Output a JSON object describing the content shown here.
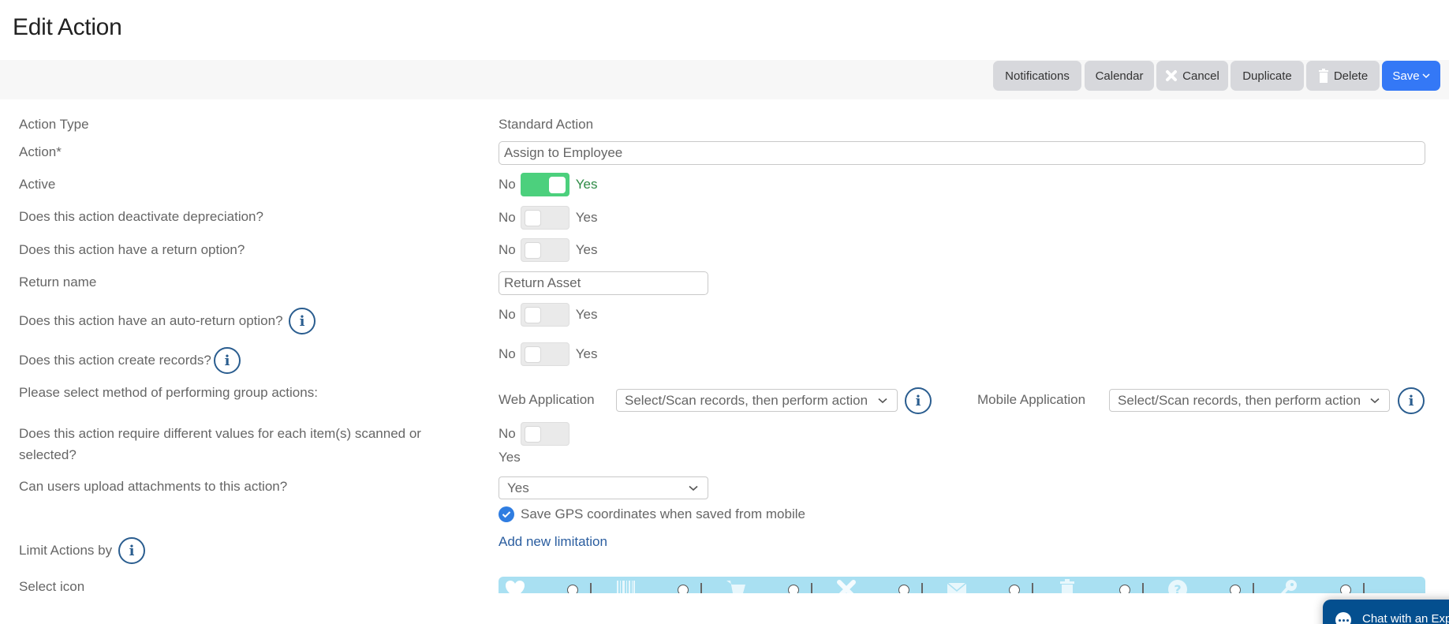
{
  "page": {
    "title": "Edit Action"
  },
  "toolbar": {
    "notifications": "Notifications",
    "calendar": "Calendar",
    "cancel": "Cancel",
    "duplicate": "Duplicate",
    "delete": "Delete",
    "save": "Save"
  },
  "form": {
    "action_type": {
      "label": "Action Type",
      "value": "Standard Action"
    },
    "action": {
      "label": "Action*",
      "value": "Assign to Employee"
    },
    "active": {
      "label": "Active",
      "no": "No",
      "yes": "Yes",
      "checked": true
    },
    "deactivate_depreciation": {
      "label": "Does this action deactivate depreciation?",
      "no": "No",
      "yes": "Yes",
      "checked": false
    },
    "return_option": {
      "label": "Does this action have a return option?",
      "no": "No",
      "yes": "Yes",
      "checked": false
    },
    "return_name": {
      "label": "Return name",
      "value": "Return Asset"
    },
    "auto_return": {
      "label": "Does this action have an auto-return option?",
      "no": "No",
      "yes": "Yes",
      "checked": false
    },
    "create_records": {
      "label": "Does this action create records?",
      "no": "No",
      "yes": "Yes",
      "checked": false
    },
    "group_actions": {
      "label": "Please select method of performing group actions:",
      "web_label": "Web Application",
      "web_value": "Select/Scan records, then perform action",
      "mobile_label": "Mobile Application",
      "mobile_value": "Select/Scan records, then perform action"
    },
    "different_values": {
      "label": "Does this action require different values for each item(s) scanned or selected?",
      "no": "No",
      "yes": "Yes",
      "checked": false
    },
    "attachments": {
      "label": "Can users upload attachments to this action?",
      "value": "Yes"
    },
    "gps": {
      "label": "Save GPS coordinates when saved from mobile",
      "checked": true
    },
    "limit": {
      "label": "Limit Actions by",
      "link": "Add new limitation"
    },
    "select_icon": {
      "label": "Select icon",
      "icons": [
        "heart-icon",
        "barcode-icon",
        "cart-icon",
        "x-icon",
        "envelope-icon",
        "trash-icon",
        "question-icon",
        "key-icon"
      ]
    }
  },
  "chat": {
    "label": "Chat with an Expert"
  },
  "colors": {
    "primary": "#3478f6",
    "toggle_on": "#4cd07d",
    "info": "#2a5d8f",
    "icon_strip": "#a9e0f2",
    "chat": "#044f8f"
  }
}
